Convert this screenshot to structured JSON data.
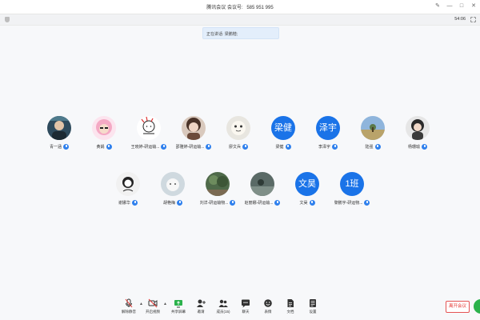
{
  "window": {
    "title": "腾讯会议",
    "meeting_label": "会议号:",
    "meeting_number": "585 951 995"
  },
  "infobar": {
    "time": "54:06"
  },
  "speaking": {
    "text": "正在讲话: 梁鹏楷;"
  },
  "participants_row1": [
    {
      "name": "青一涵",
      "initials": "",
      "avatar_color": "#2e4a5c"
    },
    {
      "name": "黄娟",
      "initials": "",
      "avatar_color": "#f4a9c4"
    },
    {
      "name": "王晓婷-研运输...",
      "initials": "",
      "avatar_color": "#ffffff"
    },
    {
      "name": "邵雅婷-研运输...",
      "initials": "",
      "avatar_color": "#6b4a3a"
    },
    {
      "name": "廖文兵",
      "initials": "",
      "avatar_color": "#e8e6e0"
    },
    {
      "name": "梁健",
      "initials": "梁健",
      "avatar_color": "#1a73e8"
    },
    {
      "name": "李泽宇",
      "initials": "泽宇",
      "avatar_color": "#1a73e8"
    },
    {
      "name": "陆强",
      "initials": "",
      "avatar_color": "#6d8fb3"
    },
    {
      "name": "杨珊瑜",
      "initials": "",
      "avatar_color": "#3a3a3a"
    }
  ],
  "participants_row2": [
    {
      "name": "谢娜华",
      "initials": "",
      "avatar_color": "#f1f1f1"
    },
    {
      "name": "胡艳梅",
      "initials": "",
      "avatar_color": "#cfd9df"
    },
    {
      "name": "刘洋-研运输物...",
      "initials": "",
      "avatar_color": "#4f6a4a"
    },
    {
      "name": "赵丽娜-研运输...",
      "initials": "",
      "avatar_color": "#5a6a66"
    },
    {
      "name": "文昊",
      "initials": "文昊",
      "avatar_color": "#1a73e8"
    },
    {
      "name": "黎鹏宇-研运物...",
      "initials": "1班",
      "avatar_color": "#1a73e8"
    }
  ],
  "toolbar": {
    "mute": "解除静音",
    "video": "开启视频",
    "share": "共享屏幕",
    "invite": "邀请",
    "members": "成员(15)",
    "chat": "聊天",
    "emoji": "表情",
    "docs": "文档",
    "settings": "设置",
    "leave": "离开会议"
  },
  "colors": {
    "accent": "#1a73e8",
    "leave": "#e53935",
    "float": "#2bb24c"
  }
}
